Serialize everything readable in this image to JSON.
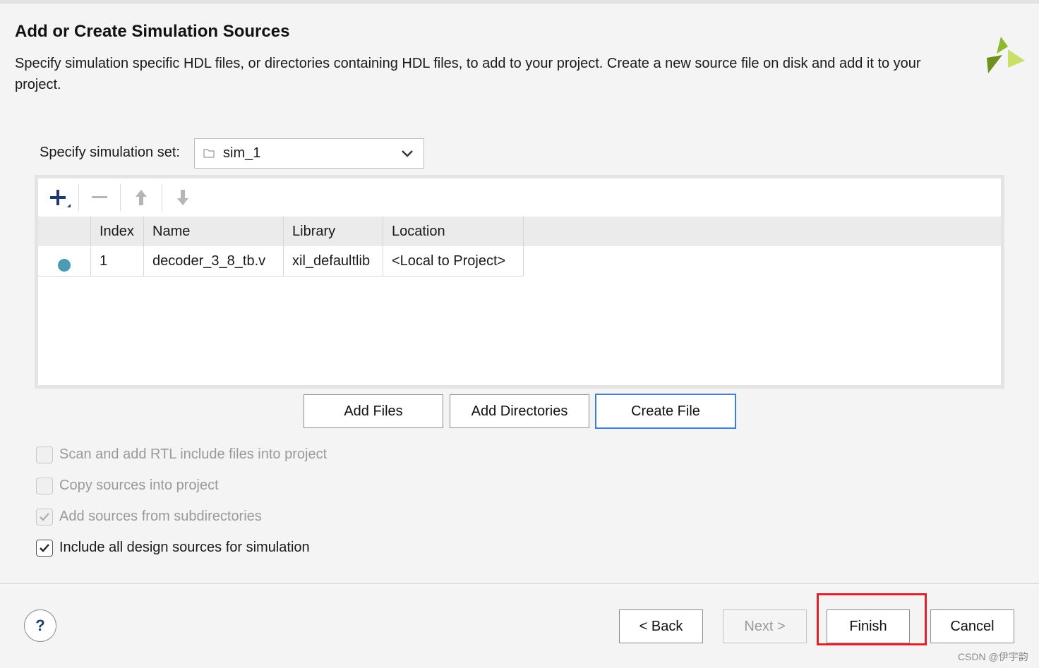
{
  "dialog": {
    "title": "Add or Create Simulation Sources",
    "description": "Specify simulation specific HDL files, or directories containing HDL files, to add to your project. Create a new source file on disk and add it to your project."
  },
  "simulation_set": {
    "label": "Specify simulation set:",
    "value": "sim_1"
  },
  "toolbar": {
    "add": "plus-icon",
    "remove": "minus-icon",
    "move_up": "arrow-up-icon",
    "move_down": "arrow-down-icon"
  },
  "table": {
    "columns": [
      "",
      "Index",
      "Name",
      "Library",
      "Location"
    ],
    "rows": [
      {
        "status": "status-dot",
        "index": "1",
        "name": "decoder_3_8_tb.v",
        "library": "xil_defaultlib",
        "location": "<Local to Project>"
      }
    ]
  },
  "actions": {
    "add_files": "Add Files",
    "add_directories": "Add Directories",
    "create_file": "Create File"
  },
  "options": [
    {
      "label": "Scan and add RTL include files into project",
      "checked": false,
      "enabled": false
    },
    {
      "label": "Copy sources into project",
      "checked": false,
      "enabled": false
    },
    {
      "label": "Add sources from subdirectories",
      "checked": true,
      "enabled": false
    },
    {
      "label": "Include all design sources for simulation",
      "checked": true,
      "enabled": true
    }
  ],
  "footer": {
    "help": "?",
    "back": "< Back",
    "next": "Next >",
    "finish": "Finish",
    "cancel": "Cancel"
  },
  "watermark": "CSDN @伊宇韵",
  "colors": {
    "accent_focus": "#3c7fd4",
    "highlight_box": "#e0202a",
    "status_dot": "#4a9bb4",
    "logo_green": "#8fb82a"
  }
}
